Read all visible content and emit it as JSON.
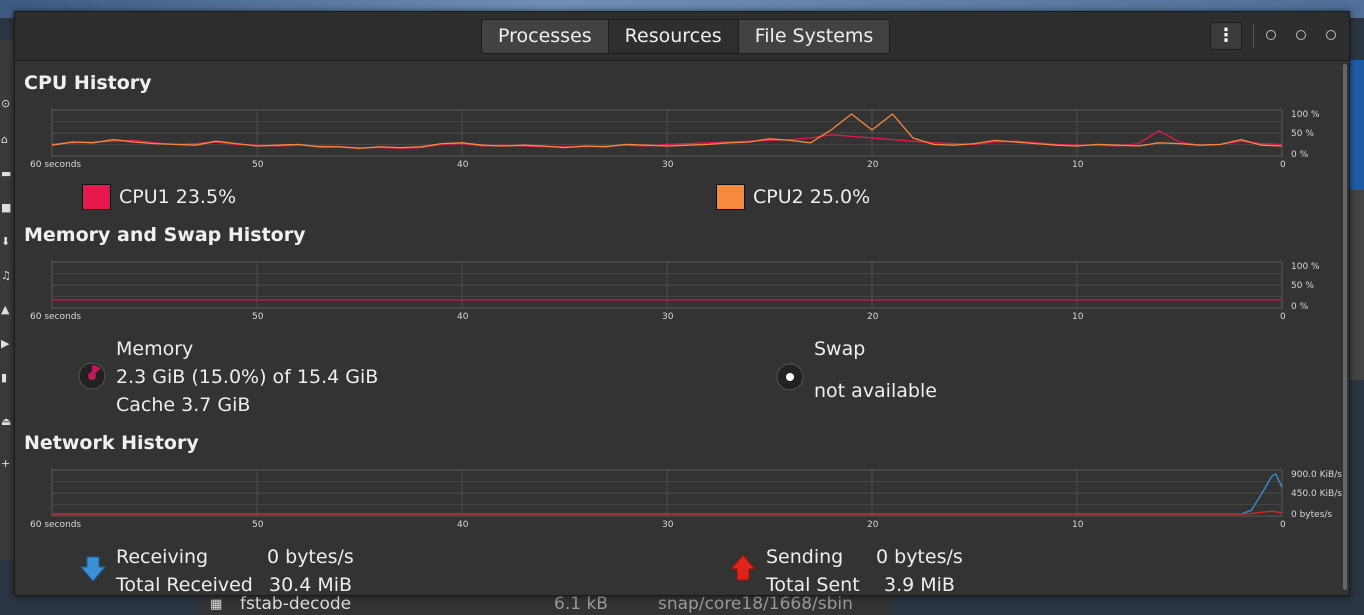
{
  "window": {
    "tabs": [
      {
        "label": "Processes",
        "active": false
      },
      {
        "label": "Resources",
        "active": true
      },
      {
        "label": "File Systems",
        "active": false
      }
    ],
    "menu_icon": "vertical-ellipsis-icon"
  },
  "cpu": {
    "title": "CPU History",
    "cpu1_label": "CPU1 23.5%",
    "cpu1_color": "#e8174d",
    "cpu2_label": "CPU2 25.0%",
    "cpu2_color": "#f6893b"
  },
  "memory": {
    "title": "Memory and Swap History",
    "memory_title": "Memory",
    "memory_used": "2.3 GiB (15.0%) of 15.4 GiB",
    "memory_cache": "Cache 3.7 GiB",
    "memory_color": "#c2185b",
    "swap_title": "Swap",
    "swap_status": "not available"
  },
  "network": {
    "title": "Network History",
    "receiving_label": "Receiving",
    "receiving_value": "0 bytes/s",
    "total_received_label": "Total Received",
    "total_received_value": "30.4 MiB",
    "sending_label": "Sending",
    "sending_value": "0 bytes/s",
    "total_sent_label": "Total Sent",
    "total_sent_value": "3.9 MiB",
    "receive_color": "#3a8fd6",
    "send_color": "#e0241b"
  },
  "background": {
    "file_name": "fstab-decode",
    "file_size": "6.1 kB",
    "file_path": "snap/core18/1668/sbin"
  },
  "chart_data": [
    {
      "type": "line",
      "title": "CPU History",
      "x_ticks": [
        "60 seconds",
        "50",
        "40",
        "30",
        "20",
        "10",
        "0"
      ],
      "y_ticks": [
        "100 %",
        "50 %",
        "0 %"
      ],
      "ylim": [
        0,
        100
      ],
      "x": [
        60,
        59,
        58,
        57,
        56,
        55,
        54,
        53,
        52,
        51,
        50,
        49,
        48,
        47,
        46,
        45,
        44,
        43,
        42,
        41,
        40,
        39,
        38,
        37,
        36,
        35,
        34,
        33,
        32,
        31,
        30,
        29,
        28,
        27,
        26,
        25,
        24,
        23,
        22,
        21,
        20,
        19,
        18,
        17,
        16,
        15,
        14,
        13,
        12,
        11,
        10,
        9,
        8,
        7,
        6,
        5,
        4,
        3,
        2,
        1,
        0
      ],
      "series": [
        {
          "name": "CPU1",
          "color": "#e8174d",
          "values": [
            25,
            28,
            30,
            32,
            34,
            28,
            24,
            26,
            30,
            24,
            22,
            20,
            22,
            20,
            18,
            16,
            16,
            14,
            16,
            24,
            26,
            20,
            22,
            20,
            18,
            18,
            18,
            20,
            22,
            20,
            24,
            26,
            28,
            30,
            32,
            34,
            36,
            40,
            48,
            44,
            40,
            36,
            32,
            28,
            26,
            24,
            30,
            32,
            28,
            24,
            22,
            22,
            20,
            26,
            58,
            30,
            22,
            24,
            32,
            26,
            24
          ]
        },
        {
          "name": "CPU2",
          "color": "#f6893b",
          "values": [
            22,
            30,
            28,
            36,
            30,
            26,
            24,
            22,
            32,
            26,
            20,
            22,
            24,
            18,
            18,
            14,
            18,
            16,
            18,
            26,
            28,
            22,
            20,
            22,
            20,
            16,
            20,
            18,
            24,
            22,
            20,
            22,
            24,
            28,
            30,
            38,
            34,
            28,
            60,
            100,
            60,
            100,
            40,
            24,
            22,
            26,
            34,
            30,
            26,
            22,
            20,
            24,
            22,
            20,
            28,
            26,
            22,
            24,
            36,
            22,
            20
          ]
        }
      ]
    },
    {
      "type": "line",
      "title": "Memory and Swap History",
      "x_ticks": [
        "60 seconds",
        "50",
        "40",
        "30",
        "20",
        "10",
        "0"
      ],
      "y_ticks": [
        "100 %",
        "50 %",
        "0 %"
      ],
      "ylim": [
        0,
        100
      ],
      "series": [
        {
          "name": "Memory",
          "color": "#c2185b",
          "values": [
            15,
            15,
            15,
            15,
            15,
            15,
            15,
            15,
            15,
            15,
            15,
            15,
            15
          ]
        }
      ]
    },
    {
      "type": "line",
      "title": "Network History",
      "x_ticks": [
        "60 seconds",
        "50",
        "40",
        "30",
        "20",
        "10",
        "0"
      ],
      "y_ticks": [
        "900.0 KiB/s",
        "450.0 KiB/s",
        "0 bytes/s"
      ],
      "ylim": [
        0,
        900
      ],
      "x": [
        60,
        50,
        40,
        30,
        20,
        10,
        2,
        1.5,
        1,
        0.5,
        0.3,
        0
      ],
      "series": [
        {
          "name": "Receiving",
          "color": "#3a8fd6",
          "values": [
            0,
            0,
            0,
            0,
            0,
            0,
            0,
            80,
            450,
            850,
            900,
            600
          ]
        },
        {
          "name": "Sending",
          "color": "#e0241b",
          "values": [
            0,
            0,
            0,
            0,
            0,
            0,
            0,
            10,
            40,
            60,
            50,
            30
          ]
        }
      ]
    }
  ]
}
